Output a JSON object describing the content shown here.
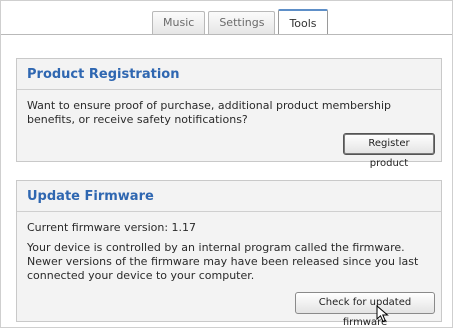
{
  "tabs": [
    {
      "label": "Music"
    },
    {
      "label": "Settings"
    },
    {
      "label": "Tools"
    }
  ],
  "registration": {
    "title": "Product Registration",
    "description": "Want to ensure proof of purchase, additional product membership benefits, or receive safety notifications?",
    "button": "Register product"
  },
  "firmware": {
    "title": "Update Firmware",
    "version_text": "Current firmware version:  1.17",
    "description": "Your device is controlled by an internal program called the firmware. Newer versions of the firmware may have been released since you last connected your device to your computer.",
    "button": "Check for updated firmware"
  },
  "icons": {
    "pointer": "mouse-cursor-icon"
  }
}
